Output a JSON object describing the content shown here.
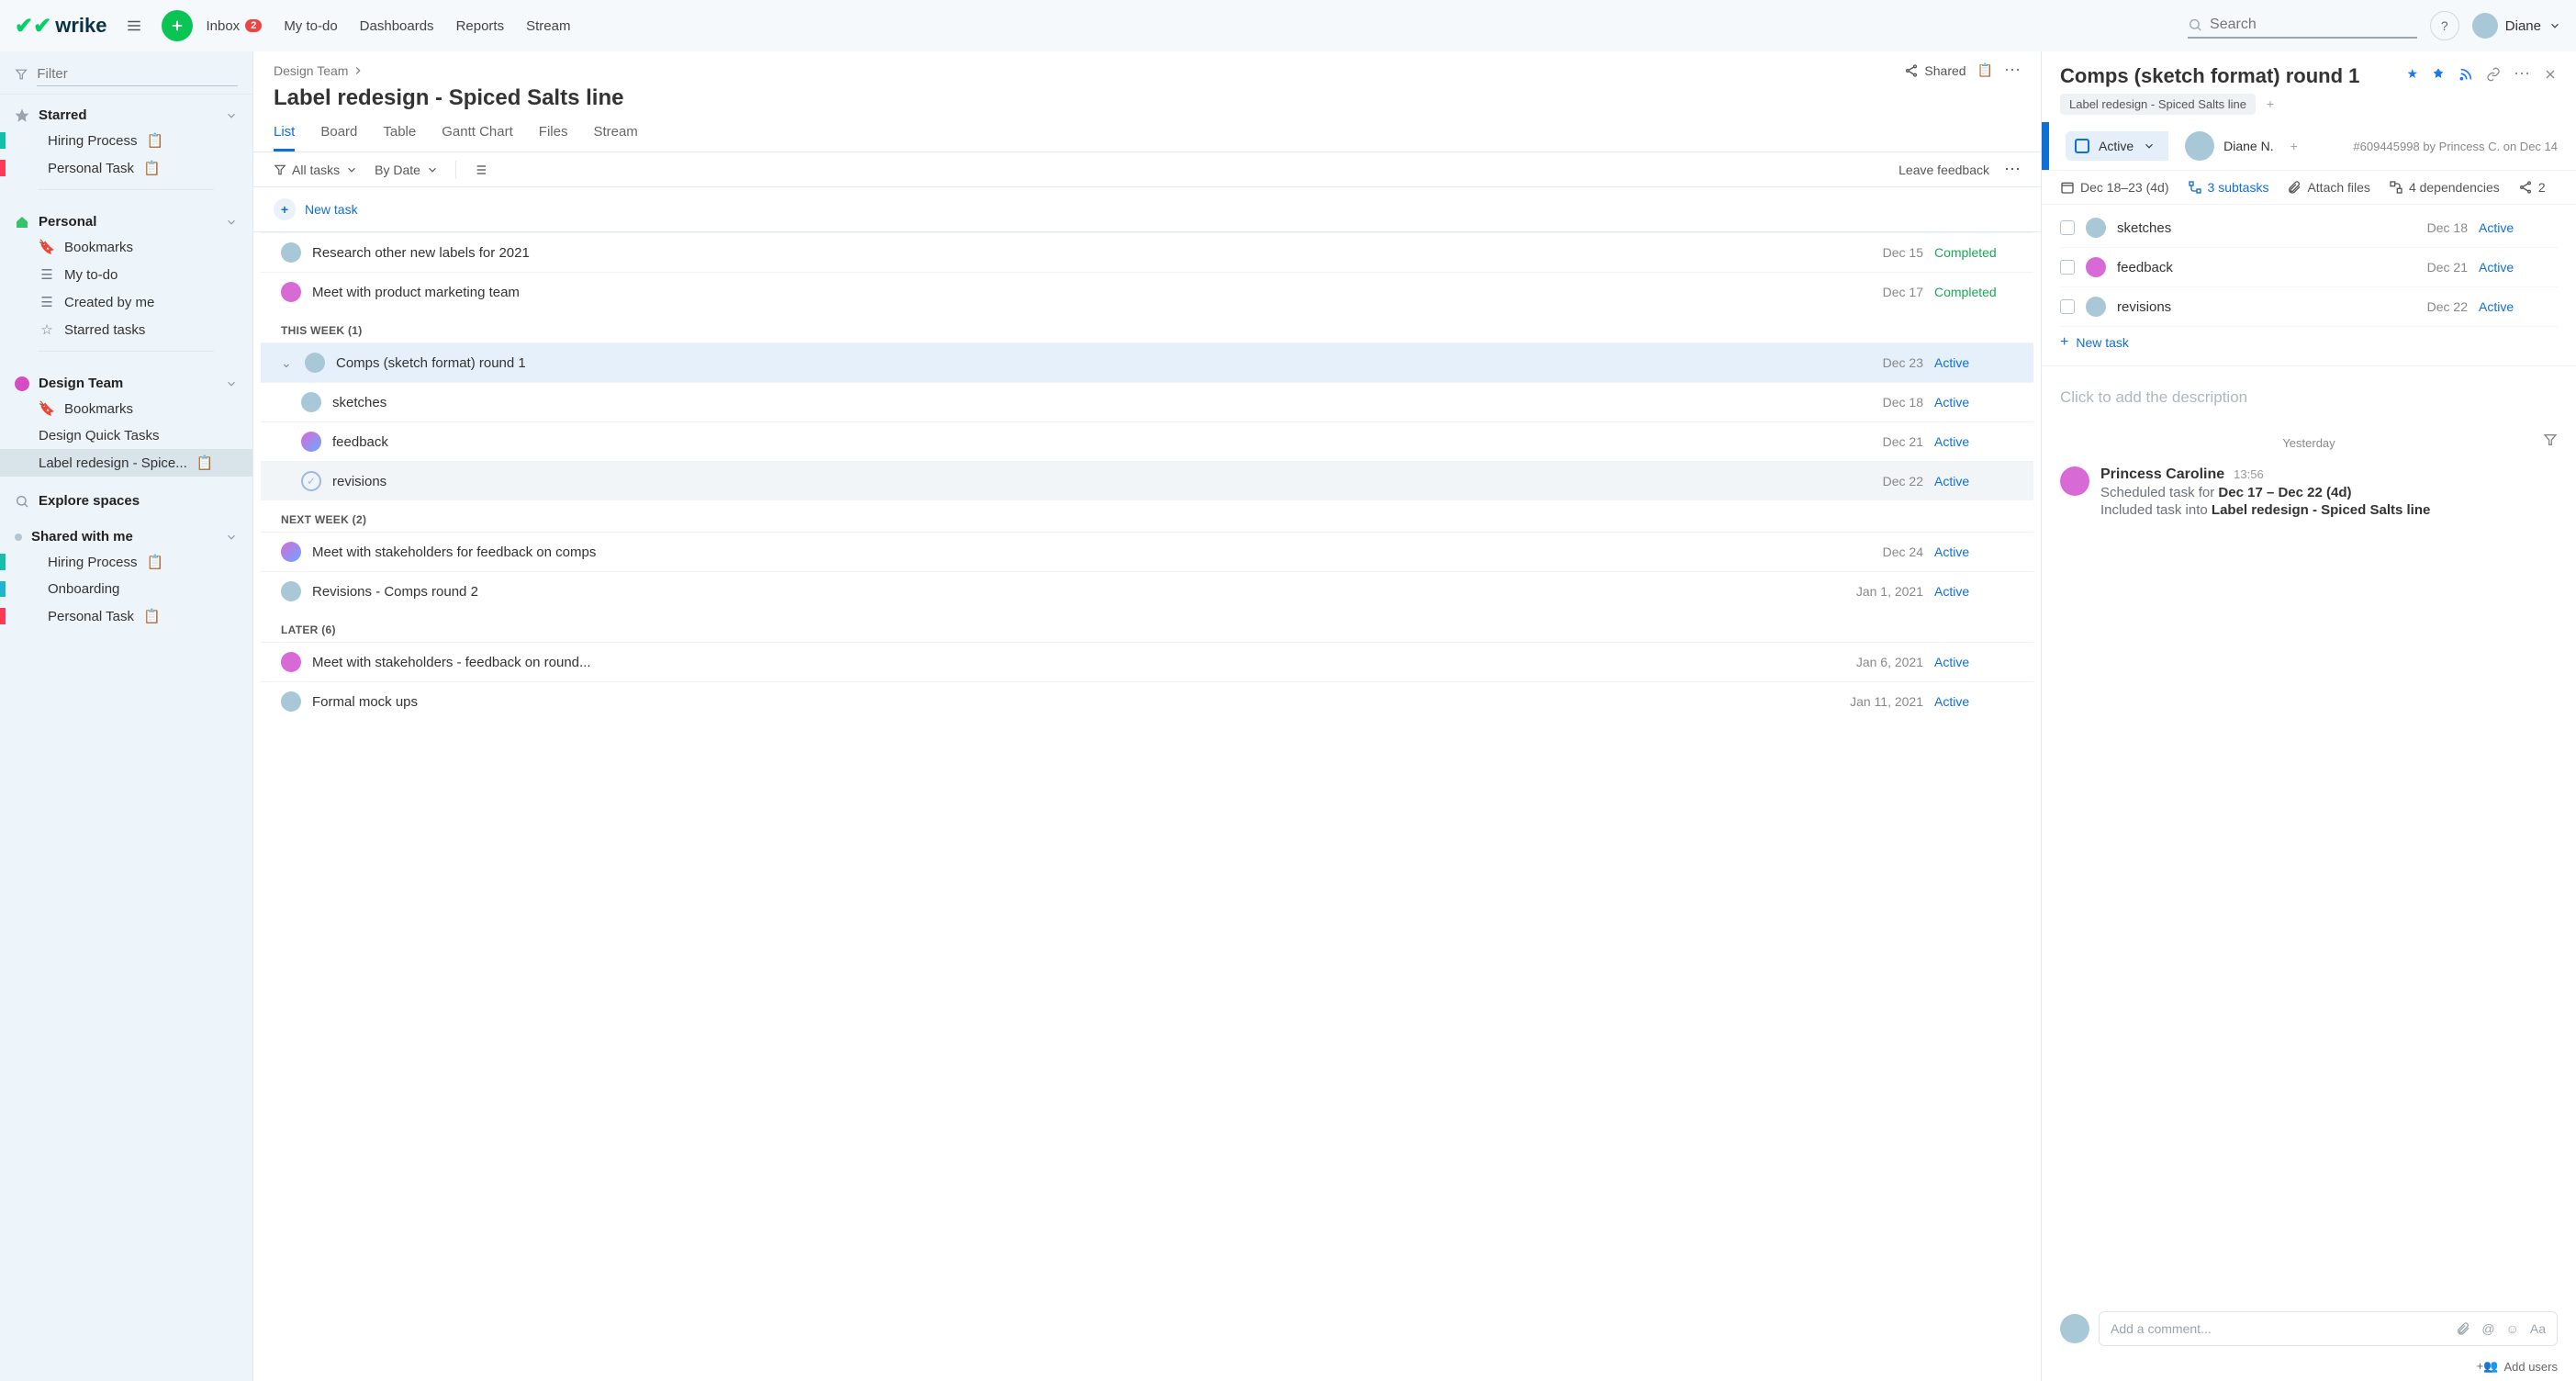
{
  "header": {
    "brand": "wrike",
    "nav": {
      "inbox": "Inbox",
      "inbox_badge": "2",
      "todo": "My to-do",
      "dashboards": "Dashboards",
      "reports": "Reports",
      "stream": "Stream"
    },
    "search_placeholder": "Search",
    "user_name": "Diane"
  },
  "sidebar": {
    "filter_placeholder": "Filter",
    "sections": {
      "starred": {
        "label": "Starred",
        "items": [
          "Hiring Process",
          "Personal Task"
        ]
      },
      "personal": {
        "label": "Personal",
        "items": [
          "Bookmarks",
          "My to-do",
          "Created by me",
          "Starred tasks"
        ]
      },
      "design": {
        "label": "Design Team",
        "items": [
          "Bookmarks",
          "Design Quick Tasks",
          "Label redesign - Spice..."
        ]
      },
      "explore": "Explore spaces",
      "shared": {
        "label": "Shared with me",
        "items": [
          "Hiring Process",
          "Onboarding",
          "Personal Task"
        ]
      }
    }
  },
  "center": {
    "breadcrumb": "Design Team",
    "shared": "Shared",
    "title": "Label redesign - Spiced Salts line",
    "tabs": [
      "List",
      "Board",
      "Table",
      "Gantt Chart",
      "Files",
      "Stream"
    ],
    "toolbar": {
      "all": "All tasks",
      "sort": "By Date",
      "feedback": "Leave feedback"
    },
    "new_task": "New task",
    "groups": [
      {
        "label": "",
        "tasks": [
          {
            "title": "Research other new labels for 2021",
            "date": "Dec 15",
            "status": "Completed"
          },
          {
            "title": "Meet with product marketing team",
            "date": "Dec 17",
            "status": "Completed"
          }
        ]
      },
      {
        "label": "THIS WEEK (1)",
        "tasks": [
          {
            "title": "Comps (sketch format) round 1",
            "date": "Dec 23",
            "status": "Active",
            "selected": true,
            "expand": true
          },
          {
            "title": "sketches",
            "date": "Dec 18",
            "status": "Active",
            "sub": true
          },
          {
            "title": "feedback",
            "date": "Dec 21",
            "status": "Active",
            "sub": true
          },
          {
            "title": "revisions",
            "date": "Dec 22",
            "status": "Active",
            "sub": true,
            "check": true
          }
        ]
      },
      {
        "label": "NEXT WEEK (2)",
        "tasks": [
          {
            "title": "Meet with stakeholders for feedback on comps",
            "date": "Dec 24",
            "status": "Active"
          },
          {
            "title": "Revisions - Comps round 2",
            "date": "Jan 1, 2021",
            "status": "Active"
          }
        ]
      },
      {
        "label": "LATER (6)",
        "tasks": [
          {
            "title": "Meet with stakeholders - feedback on round...",
            "date": "Jan 6, 2021",
            "status": "Active"
          },
          {
            "title": "Formal mock ups",
            "date": "Jan 11, 2021",
            "status": "Active"
          }
        ]
      }
    ]
  },
  "detail": {
    "title": "Comps (sketch format) round 1",
    "parent": "Label redesign - Spiced Salts line",
    "status": "Active",
    "assignee": "Diane N.",
    "meta": "#609445998 by Princess C. on Dec 14",
    "dates": "Dec 18–23 (4d)",
    "subtasks_link": "3 subtasks",
    "attach": "Attach files",
    "dependencies": "4 dependencies",
    "share_count": "2",
    "subtasks": [
      {
        "title": "sketches",
        "date": "Dec 18",
        "status": "Active"
      },
      {
        "title": "feedback",
        "date": "Dec 21",
        "status": "Active"
      },
      {
        "title": "revisions",
        "date": "Dec 22",
        "status": "Active"
      }
    ],
    "new_task": "New task",
    "desc_placeholder": "Click to add the description",
    "activity_day": "Yesterday",
    "activity": {
      "name": "Princess Caroline",
      "time": "13:56",
      "line1_prefix": "Scheduled task for ",
      "line1_bold": "Dec 17 – Dec 22 (4d)",
      "line2_prefix": "Included task into ",
      "line2_bold": "Label redesign - Spiced Salts line"
    },
    "comment_placeholder": "Add a comment...",
    "add_users": "Add users"
  }
}
